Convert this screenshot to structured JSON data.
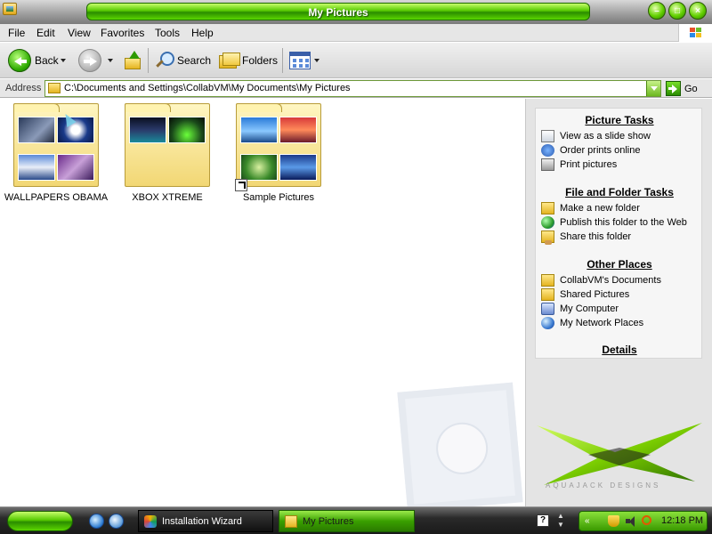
{
  "window": {
    "title": "My Pictures"
  },
  "menu": {
    "items": [
      "File",
      "Edit",
      "View",
      "Favorites",
      "Tools",
      "Help"
    ]
  },
  "toolbar": {
    "back_label": "Back",
    "search_label": "Search",
    "folders_label": "Folders"
  },
  "address": {
    "label": "Address",
    "value": "C:\\Documents and Settings\\CollabVM\\My Documents\\My Pictures",
    "go_label": "Go"
  },
  "folders": [
    {
      "name": "WALLPAPERS OBAMA"
    },
    {
      "name": "XBOX XTREME"
    },
    {
      "name": "Sample Pictures"
    }
  ],
  "taskpane": {
    "picture_tasks": {
      "title": "Picture Tasks",
      "items": [
        "View as a slide show",
        "Order prints online",
        "Print pictures"
      ]
    },
    "file_folder_tasks": {
      "title": "File and Folder Tasks",
      "items": [
        "Make a new folder",
        "Publish this folder to the Web",
        "Share this folder"
      ]
    },
    "other_places": {
      "title": "Other Places",
      "items": [
        "CollabVM's Documents",
        "Shared Pictures",
        "My Computer",
        "My Network Places"
      ]
    },
    "details": {
      "title": "Details"
    },
    "brand_text": "AQUAJACK DESIGNS"
  },
  "taskbar": {
    "buttons": [
      "Installation Wizard",
      "My Pictures"
    ],
    "clock": "12:18 PM"
  },
  "colors": {
    "accent_green": "#55c800",
    "folder_yellow": "#f2d774"
  }
}
